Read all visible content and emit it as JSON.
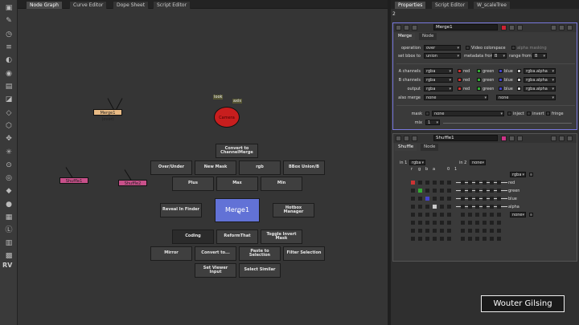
{
  "nodegraph_tabs": [
    "Node Graph",
    "Curve Editor",
    "Dope Sheet",
    "Script Editor"
  ],
  "properties_tabs": [
    "Properties",
    "Script Editor",
    "W_scaleTree"
  ],
  "properties_count": "2",
  "toolbar_label": "RV",
  "graph": {
    "nodes": {
      "merge_top": "Merge1 (over)",
      "camera": "Camera",
      "shuffle1": "Shuffle1",
      "shuffle2": "Shuffle2"
    },
    "inputs": {
      "look": "look",
      "axis": "axis"
    }
  },
  "menu": {
    "convert": "Convert to ChannelMerge",
    "over_under": "Over/Under",
    "new_mask": "New Mask",
    "rgb": "rgb",
    "bbox_union": "BBox Union/B",
    "plus": "Plus",
    "max": "Max",
    "min": "Min",
    "reveal": "Reveal In Finder",
    "center": "Merge1",
    "hotbox": "Hotbox Manager",
    "coding": "Coding",
    "reform": "ReformThat",
    "toggle_mask": "Toggle Invert Mask",
    "mirror": "Mirror",
    "convert_to": "Convert to...",
    "paste_sel": "Paste to Selection",
    "filter_sel": "Filter Selection",
    "set_viewer": "Set Viewer Input",
    "select_similar": "Select Similar"
  },
  "merge_panel": {
    "name": "Merge1",
    "tabs": [
      "Merge",
      "Node"
    ],
    "operation_label": "operation",
    "operation": "over",
    "video_colorspace": "Video colorspace",
    "alpha_masking": "alpha masking",
    "bbox_label": "set bbox to",
    "bbox": "union",
    "metadata_label": "metadata from",
    "metadata": "B",
    "range_label": "range from",
    "range": "B",
    "a_channels_label": "A channels",
    "a_channels": "rgba",
    "b_channels_label": "B channels",
    "b_channels": "rgba",
    "output_label": "output",
    "output": "rgba",
    "also_merge_label": "also merge",
    "also_merge": "none",
    "also_merge2": "none",
    "ch_red": "red",
    "ch_green": "green",
    "ch_blue": "blue",
    "ch_alpha": "rgba.alpha",
    "mask_label": "mask",
    "mask": "none",
    "inject": "inject",
    "invert": "invert",
    "fringe": "fringe",
    "mix_label": "mix",
    "mix_value": "1"
  },
  "shuffle_panel": {
    "name": "Shuffle1",
    "tabs": [
      "Shuffle",
      "Node"
    ],
    "in1_label": "in 1",
    "in1": "rgba",
    "in2_label": "in 2",
    "in2": "none",
    "col_labels": [
      "r",
      "g",
      "b",
      "a"
    ],
    "zero_one": [
      "0",
      "1"
    ],
    "out1": "rgba",
    "out2": "none",
    "outputs": [
      "red",
      "green",
      "blue",
      "alpha"
    ]
  },
  "watermark": "Wouter Gilsing",
  "colors": {
    "menu_highlight": "#6272d6",
    "camera_node": "#c81e1e",
    "shuffle_node": "#c8508a",
    "merge_node": "#e9bb85",
    "selection_outline": "#7a7adf"
  }
}
